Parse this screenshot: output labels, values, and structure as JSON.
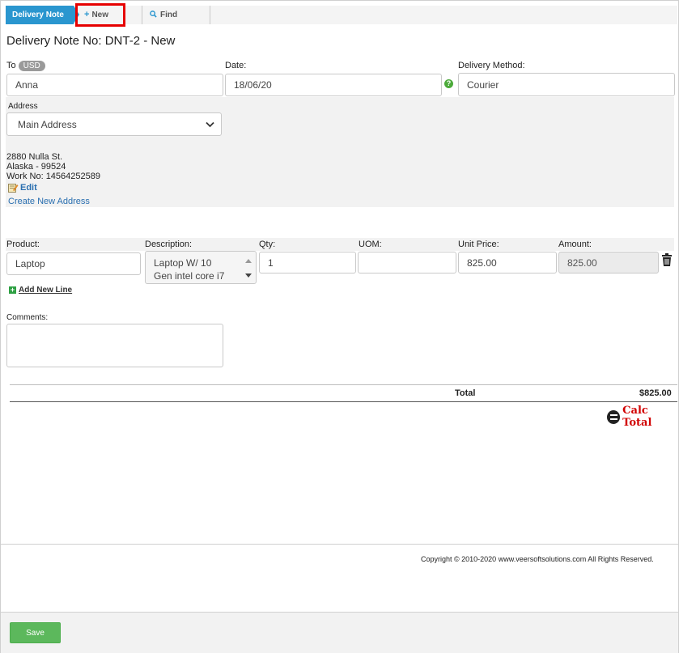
{
  "tabs": {
    "active": "Delivery Note",
    "new": "New",
    "find": "Find"
  },
  "page_title": "Delivery Note No: DNT-2 - New",
  "form": {
    "to_label": "To",
    "currency": "USD",
    "to_value": "Anna",
    "date_label": "Date:",
    "date_value": "18/06/20",
    "delivery_method_label": "Delivery Method:",
    "delivery_method_value": "Courier",
    "address_label": "Address",
    "address_selected": "Main Address",
    "address_lines": [
      "2880 Nulla St.",
      "Alaska - 99524",
      "Work No: 14564252589"
    ],
    "edit_link": "Edit",
    "create_address_link": "Create New Address"
  },
  "lines": {
    "headers": {
      "product": "Product:",
      "description": "Description:",
      "qty": "Qty:",
      "uom": "UOM:",
      "unit_price": "Unit Price:",
      "amount": "Amount:"
    },
    "rows": [
      {
        "product": "Laptop",
        "description_line1": "Laptop W/ 10",
        "description_line2": "Gen intel core i7",
        "qty": "1",
        "uom": "",
        "unit_price": "825.00",
        "amount": "825.00"
      }
    ],
    "add_new_line": "Add New Line"
  },
  "comments_label": "Comments:",
  "totals": {
    "label": "Total",
    "value": "$825.00",
    "calc_button": "Calc Total"
  },
  "footer": {
    "copyright": "Copyright © 2010-2020 www.veersoftsolutions.com All Rights Reserved."
  },
  "actions": {
    "save": "Save"
  },
  "colors": {
    "accent": "#2a96cf",
    "highlight_border": "#e60000",
    "save_button": "#5cb85c",
    "calc_text": "#d10000"
  }
}
